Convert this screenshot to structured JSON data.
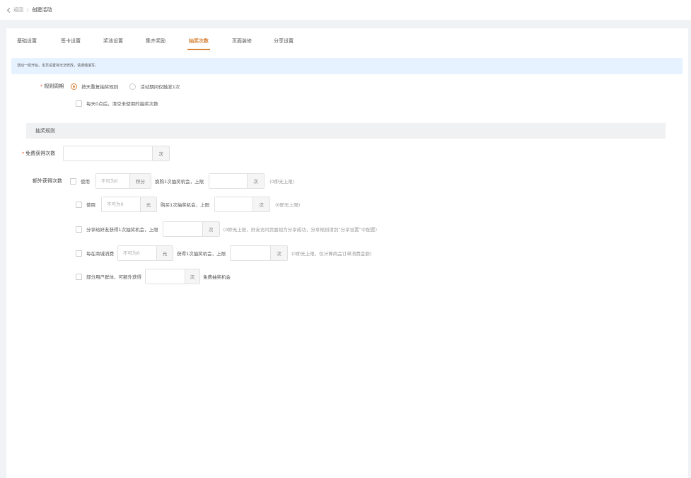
{
  "breadcrumb": {
    "back": "返回",
    "separator": "/",
    "current": "创建活动"
  },
  "tabs": [
    {
      "label": "基础设置",
      "active": false
    },
    {
      "label": "签卡设置",
      "active": false
    },
    {
      "label": "奖池设置",
      "active": false
    },
    {
      "label": "集齐奖励",
      "active": false
    },
    {
      "label": "抽奖次数",
      "active": true
    },
    {
      "label": "页面装修",
      "active": false
    },
    {
      "label": "分享设置",
      "active": false
    }
  ],
  "notice": "活动一经开始，本页设置将无法修改，请谨慎填写。",
  "rule_cycle": {
    "label": "规则周期",
    "options": [
      {
        "label": "按天重复抽奖规则",
        "selected": true
      },
      {
        "label": "活动期间仅触发1次",
        "selected": false
      }
    ],
    "reset_checkbox": "每天0点后，清空未使用的抽奖次数"
  },
  "section_title": "抽奖规则",
  "free_times": {
    "label": "免费获得次数",
    "value": "",
    "suffix": "次"
  },
  "extra": {
    "label": "额外获得次数",
    "points": {
      "prefix": "使用",
      "placeholder": "不可为0",
      "unit": "积分",
      "mid": "换购1次抽奖机会，上限",
      "limit_suffix": "次",
      "hint": "(0即无上限)"
    },
    "cash": {
      "prefix": "使用",
      "placeholder": "不可为0",
      "unit": "元",
      "mid": "购买1次抽奖机会，上限",
      "limit_suffix": "次",
      "hint": "(0即无上限)"
    },
    "share": {
      "text": "分享给好友获得1次抽奖机会，上限",
      "limit_suffix": "次",
      "hint": "(0即无上限，好友访问页面视为分享成功，分享规则请到“分享设置”中配置)"
    },
    "spend": {
      "prefix": "每在商城消费",
      "placeholder": "不可为0",
      "unit": "元",
      "mid": "获得1次抽奖机会，上限",
      "limit_suffix": "次",
      "hint": "(0即无上限，仅计算商品订单消费金额)"
    },
    "group": {
      "prefix": "部分用户群体，可额外获得",
      "suffix": "次",
      "after": "免费抽奖机会"
    }
  },
  "colors": {
    "accent": "#d8843a",
    "required": "#e4572e",
    "notice_bg": "#e6f2ff"
  }
}
